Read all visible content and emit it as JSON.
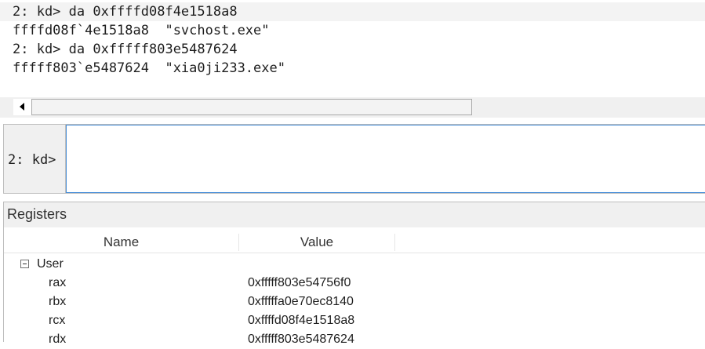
{
  "output": {
    "lines": [
      "2: kd> da 0xffffd08f4e1518a8",
      "ffffd08f`4e1518a8  \"svchost.exe\"",
      "2: kd> da 0xfffff803e5487624",
      "fffff803`e5487624  \"xia0ji233.exe\""
    ]
  },
  "command": {
    "prompt": "2: kd>",
    "value": ""
  },
  "registers": {
    "title": "Registers",
    "columns": [
      "Name",
      "Value"
    ],
    "group": "User",
    "rows": [
      {
        "name": "rax",
        "value": "0xfffff803e54756f0"
      },
      {
        "name": "rbx",
        "value": "0xfffffa0e70ec8140"
      },
      {
        "name": "rcx",
        "value": "0xffffd08f4e1518a8"
      },
      {
        "name": "rdx",
        "value": "0xfffff803e5487624"
      }
    ]
  }
}
